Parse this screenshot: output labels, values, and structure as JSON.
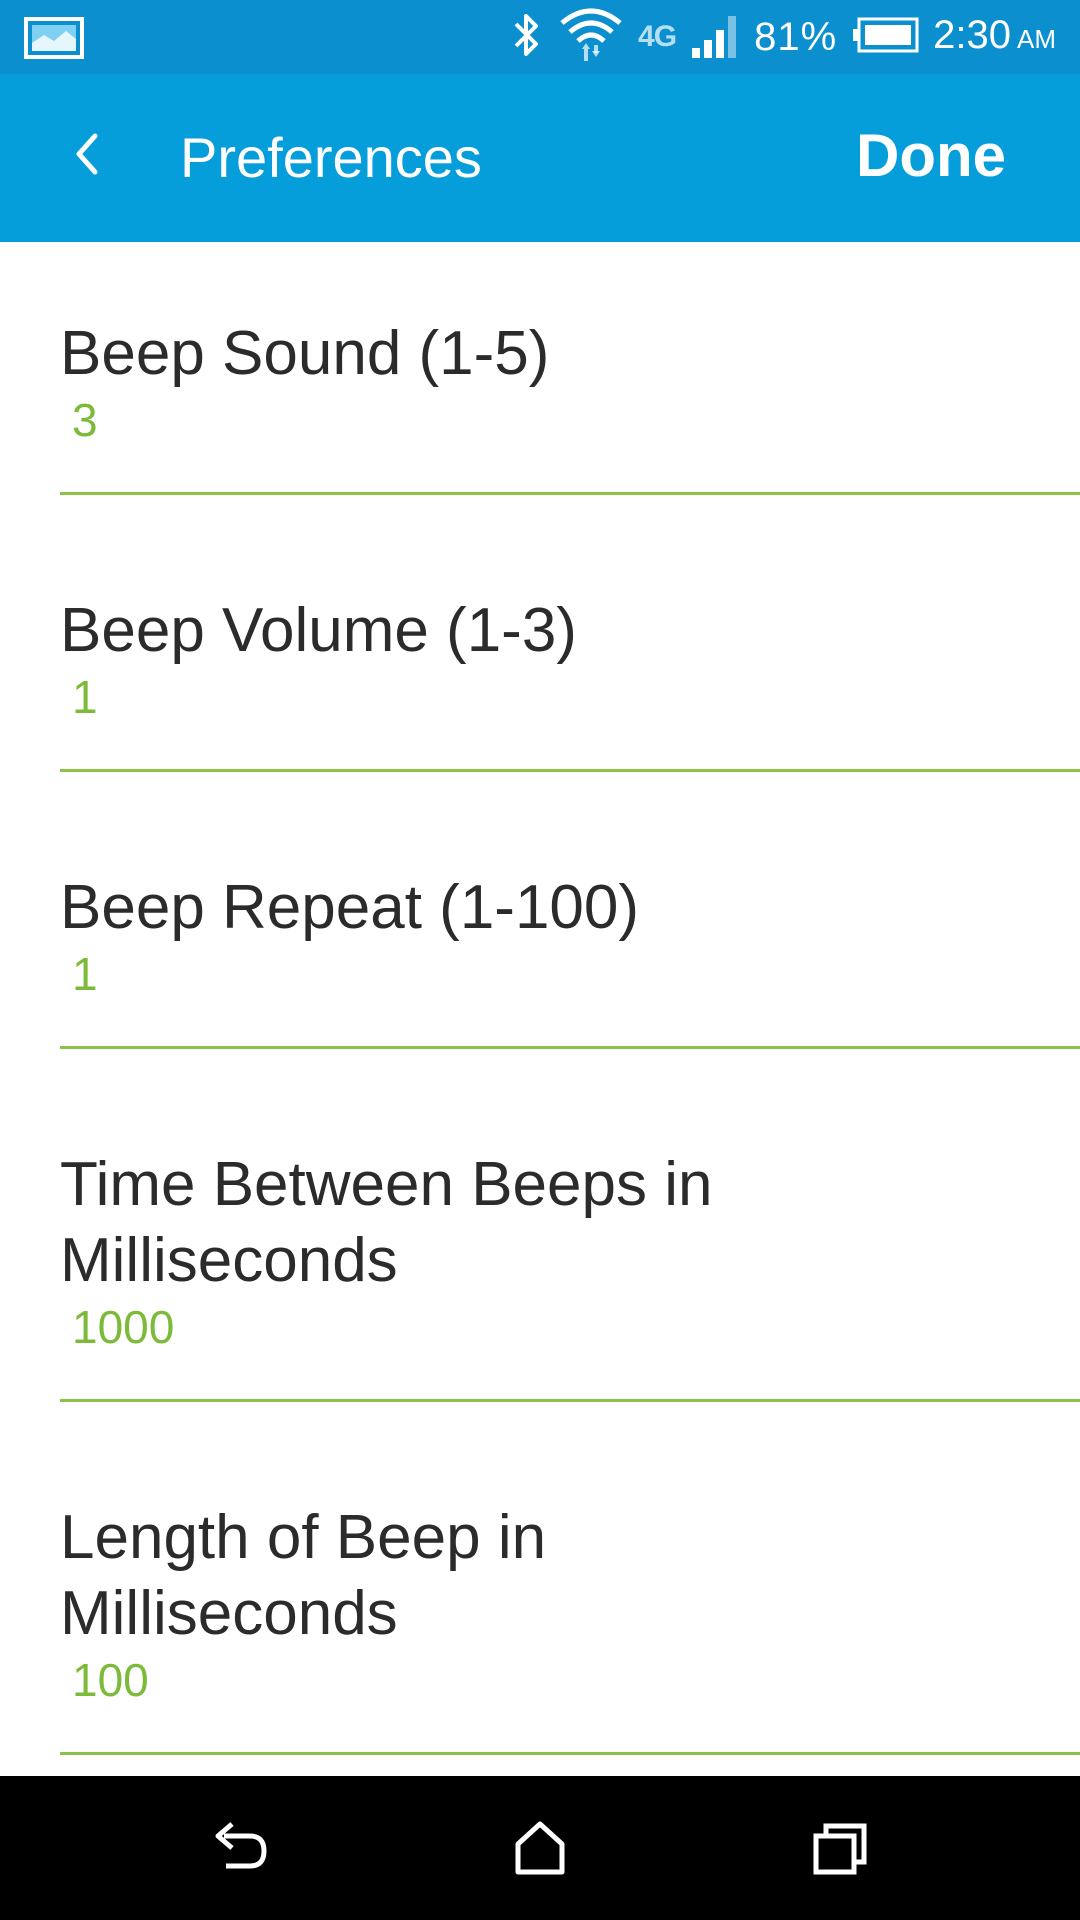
{
  "status_bar": {
    "network_label": "4G",
    "battery_percent": "81%",
    "time": "2:30",
    "am_pm": "AM"
  },
  "app_bar": {
    "title": "Preferences",
    "done_label": "Done"
  },
  "preferences": [
    {
      "label": "Beep Sound (1-5)",
      "value": "3"
    },
    {
      "label": "Beep Volume (1-3)",
      "value": "1"
    },
    {
      "label": "Beep Repeat (1-100)",
      "value": "1"
    },
    {
      "label": "Time Between Beeps in Milliseconds",
      "value": "1000"
    },
    {
      "label": "Length of Beep in Milliseconds",
      "value": "100"
    }
  ],
  "colors": {
    "status_bar": "#0b8fcf",
    "app_bar": "#069ddb",
    "accent_green": "#8bc34a",
    "value_green": "#7cba3a"
  }
}
